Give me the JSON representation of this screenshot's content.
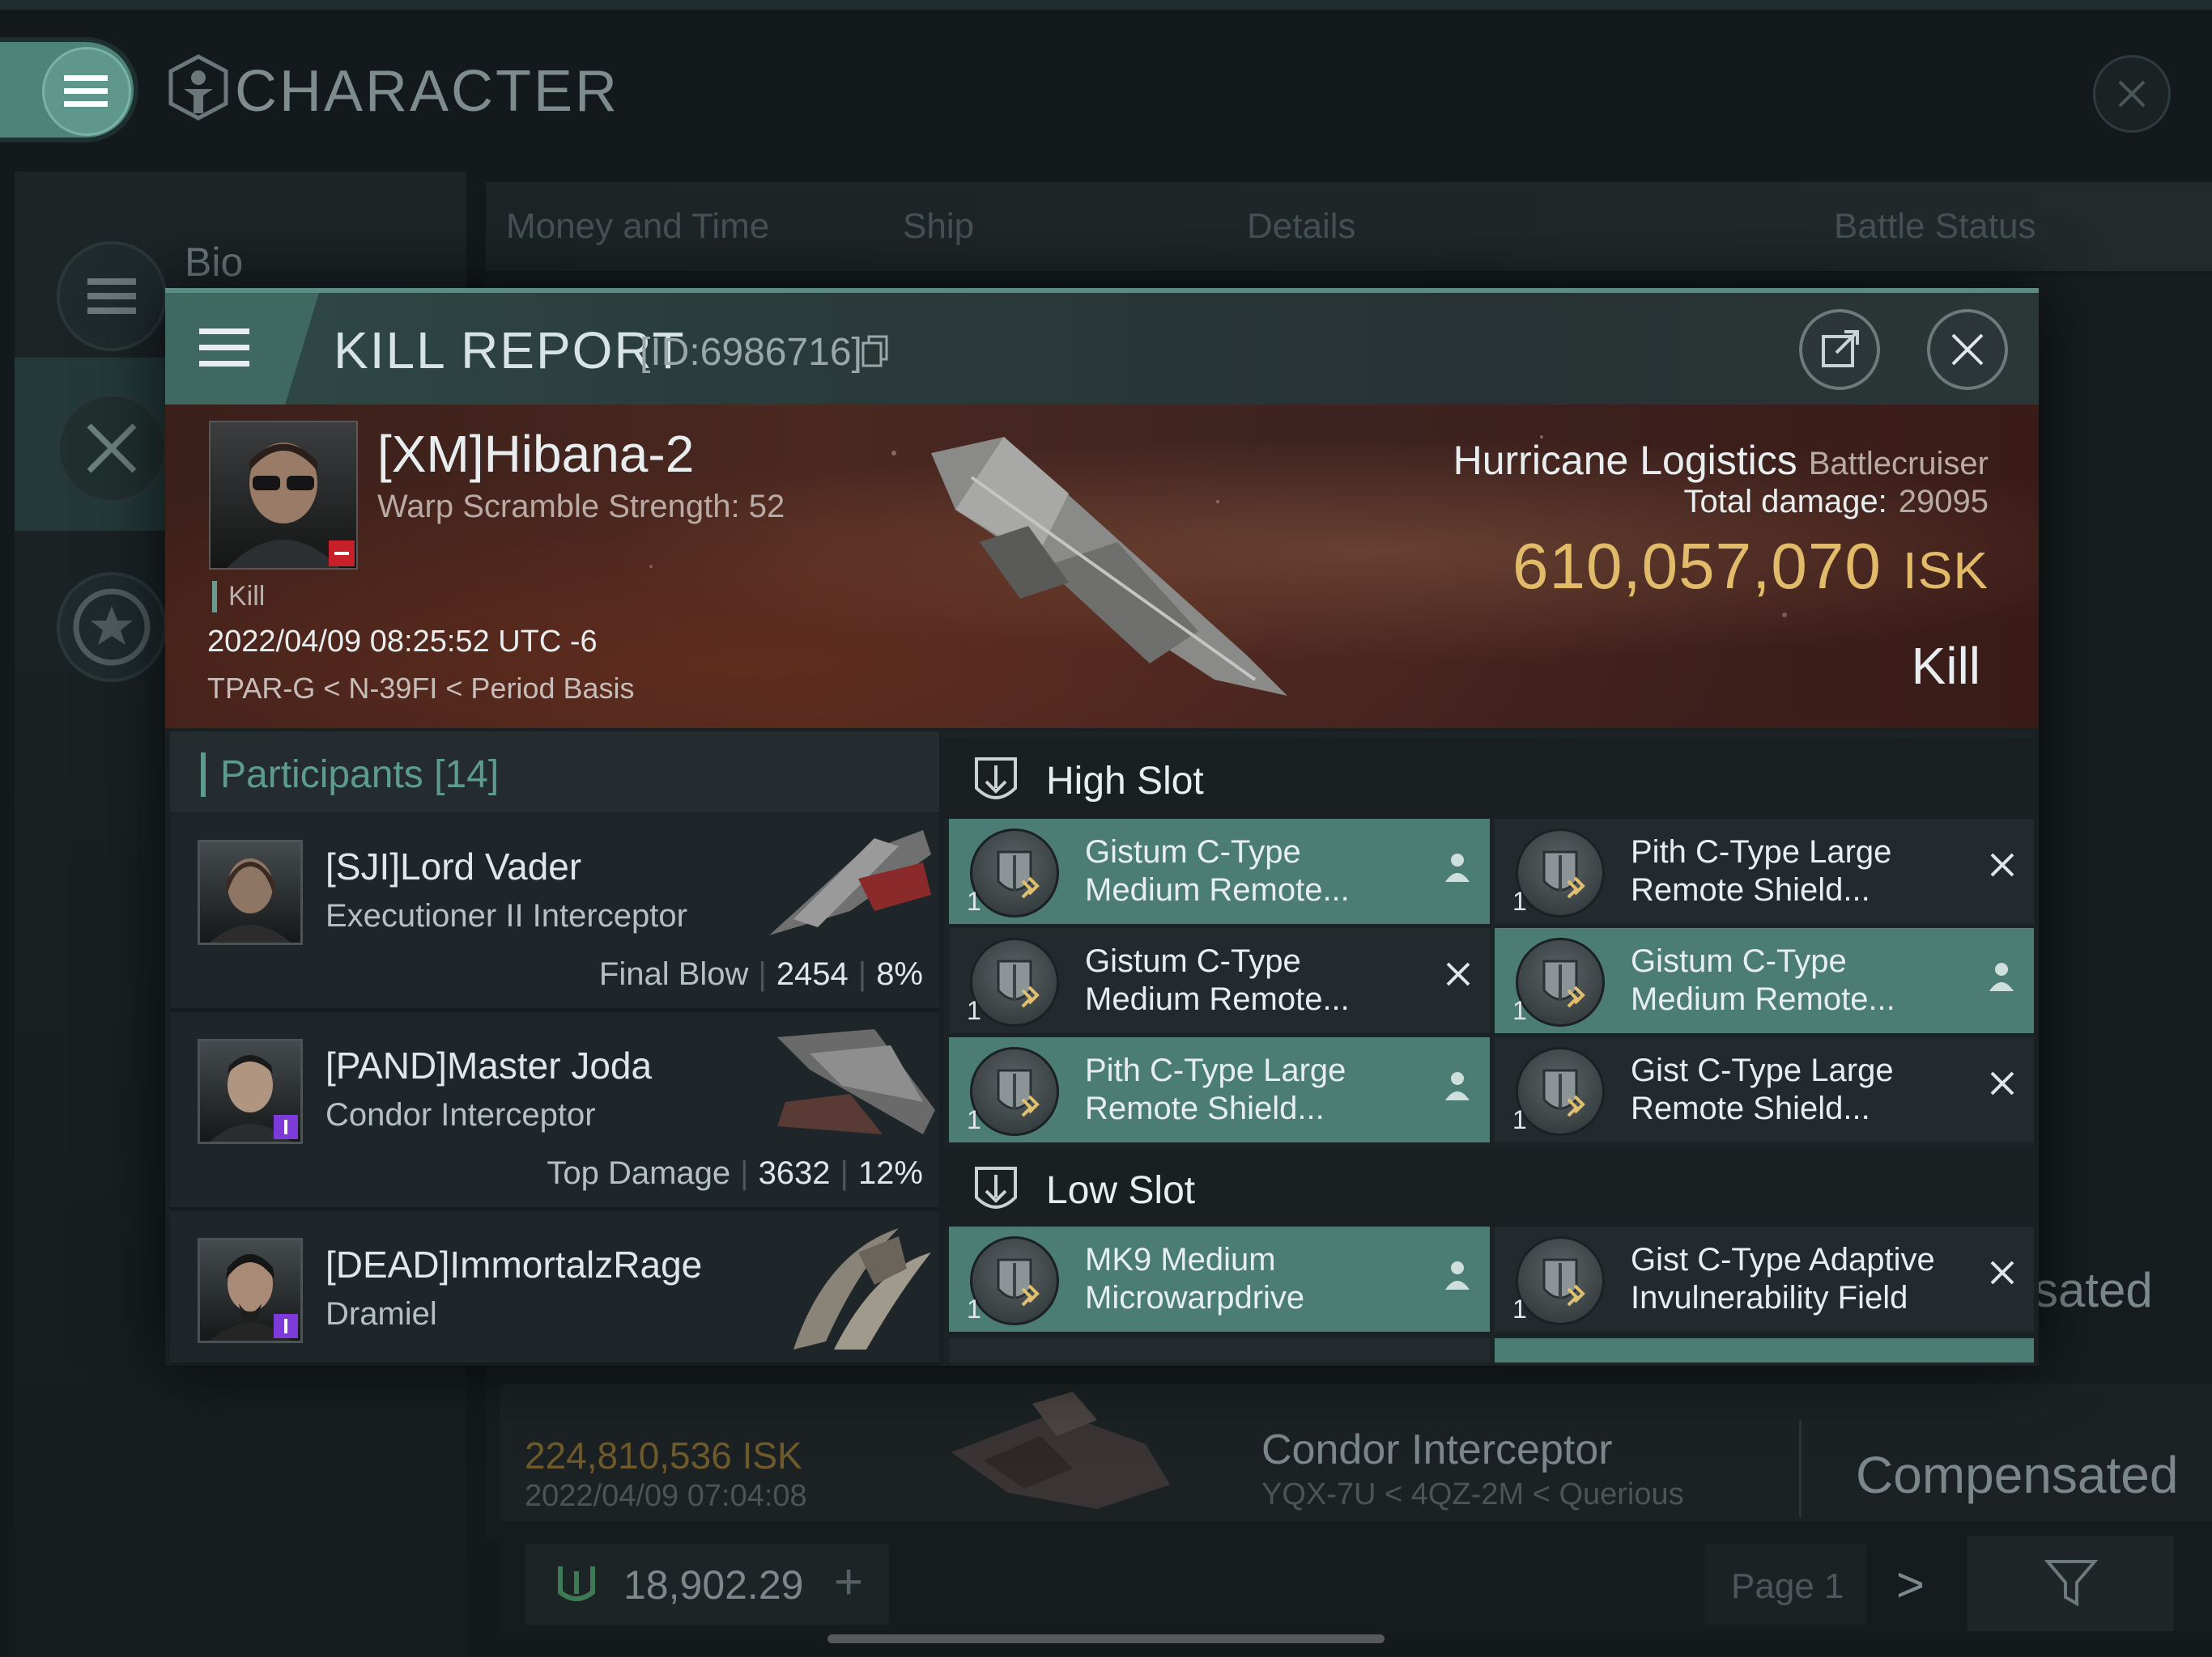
{
  "background": {
    "title": "CHARACTER",
    "sidebar": {
      "bio_label": "Bio"
    },
    "tabs": [
      "Money and Time",
      "Ship",
      "Details",
      "Battle Status"
    ],
    "row_right_status": "sated",
    "row": {
      "isk": "224,810,536 ISK",
      "date": "2022/04/09  07:04:08",
      "ship_name": "Condor Interceptor",
      "location": "YQX-7U < 4QZ-2M < Querious",
      "status": "Compensated"
    },
    "wallet": {
      "value": "18,902.29",
      "add": "+"
    },
    "pagination": {
      "label": "Page 1",
      "next": ">"
    }
  },
  "kill_report": {
    "title": "KILL REPORT",
    "id": "[ID:6986716]",
    "victim": {
      "name": "[XM]Hibana-2",
      "scram": "Warp Scramble Strength: 52",
      "tag": "Kill",
      "time": "2022/04/09 08:25:52 UTC -6",
      "location": "TPAR-G < N-39FI < Period Basis"
    },
    "ship": {
      "name": "Hurricane Logistics",
      "class": "Battlecruiser",
      "damage_label": "Total damage:",
      "damage_value": "29095",
      "isk_value": "610,057,070",
      "isk_unit": "ISK",
      "result": "Kill"
    },
    "participants": {
      "title": "Participants",
      "count": "[14]",
      "items": [
        {
          "name": "[SJI]Lord Vader",
          "ship": "Executioner II Interceptor",
          "label": "Final Blow",
          "damage": "2454",
          "pct": "8%"
        },
        {
          "name": "[PAND]Master Joda",
          "ship": "Condor Interceptor",
          "label": "Top Damage",
          "damage": "3632",
          "pct": "12%"
        },
        {
          "name": "[DEAD]ImmortalzRage",
          "ship": "Dramiel"
        }
      ]
    },
    "high_slot": {
      "title": "High Slot",
      "modules": [
        {
          "name": "Gistum C-Type Medium Remote...",
          "qty": "1",
          "state": "person-icon",
          "highlight": true
        },
        {
          "name": "Pith C-Type Large Remote Shield...",
          "qty": "1",
          "state": "x-icon",
          "highlight": false
        },
        {
          "name": "Gistum C-Type Medium Remote...",
          "qty": "1",
          "state": "x-icon",
          "highlight": false
        },
        {
          "name": "Gistum C-Type Medium Remote...",
          "qty": "1",
          "state": "person-icon",
          "highlight": true
        },
        {
          "name": "Pith C-Type Large Remote Shield...",
          "qty": "1",
          "state": "person-icon",
          "highlight": true
        },
        {
          "name": "Gist C-Type Large Remote Shield...",
          "qty": "1",
          "state": "x-icon",
          "highlight": false
        }
      ]
    },
    "low_slot": {
      "title": "Low Slot",
      "modules": [
        {
          "name": "MK9 Medium Microwarpdrive",
          "qty": "1",
          "state": "person-icon",
          "highlight": true
        },
        {
          "name": "Gist C-Type Adaptive Invulnerability Field",
          "qty": "1",
          "state": "x-icon",
          "highlight": false
        }
      ]
    }
  },
  "colors": {
    "accent": "#4c7d74",
    "isk_gold": "#e2bb6a",
    "banner_red": "#4a2820",
    "participants_teal": "#5d9a90"
  }
}
